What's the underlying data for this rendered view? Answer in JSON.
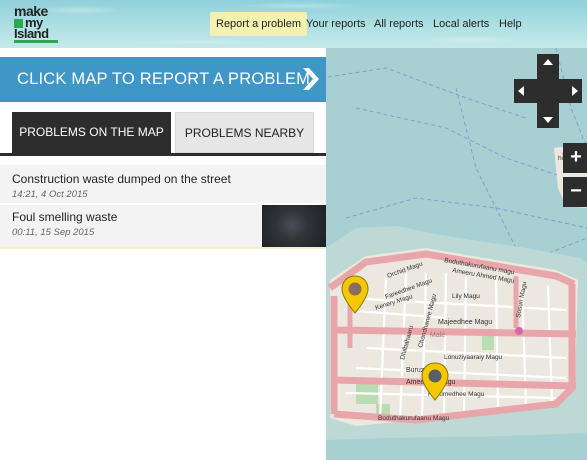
{
  "header": {
    "logo": {
      "line1": "make",
      "line2": "my",
      "line3": "Island"
    },
    "nav": [
      {
        "label": "Report a problem",
        "active": true
      },
      {
        "label": "Your reports",
        "active": false
      },
      {
        "label": "All reports",
        "active": false
      },
      {
        "label": "Local alerts",
        "active": false
      },
      {
        "label": "Help",
        "active": false
      }
    ]
  },
  "banner": {
    "label": "CLICK MAP TO REPORT A PROBLEM"
  },
  "tabs": [
    {
      "label": "PROBLEMS ON THE MAP",
      "active": true
    },
    {
      "label": "PROBLEMS NEARBY",
      "active": false
    }
  ],
  "reports": [
    {
      "title": "Construction waste dumped on the street",
      "time": "14:21, 4 Oct 2015",
      "has_photo": false
    },
    {
      "title": "Foul smelling waste",
      "time": "00:11, 15 Sep 2015",
      "has_photo": true
    }
  ],
  "map": {
    "labels": {
      "boduthakurufaanu_top": "Boduthakurufaanu magu",
      "ameeru_ahmed": "Ameeru Ahmed Magu",
      "orchid": "Orchid Magu",
      "fareedhee": "Fareedhee Magu",
      "kenery": "Kenery Magu",
      "lily": "Lily Magu",
      "majeedhee": "Majeedhee Magu",
      "male": "Malé",
      "chandhanee": "Chandhanee Magu",
      "dhilbahaaru": "Dhilbahaaru",
      "lonuziyaaraiy": "Lonuziyaaraiy Magu",
      "buruzu": "Buruzu",
      "ameenee": "Ameenee Magu",
      "fahumedhee": "Fahumedhee Magu",
      "boduthakurufaanu_bottom": "Boduthakurufaanu Magu",
      "sosun": "Sosun Magu",
      "hulhumale": "hoonidh"
    },
    "controls": {
      "zoom_in": "+",
      "zoom_out": "−"
    }
  },
  "colors": {
    "banner": "#3f97c8",
    "active_tab": "#2d2d2d",
    "nav_active": "#f4f0b0",
    "pin": "#f5c800",
    "road": "#e8a6ab",
    "water": "#a8d0d2"
  }
}
